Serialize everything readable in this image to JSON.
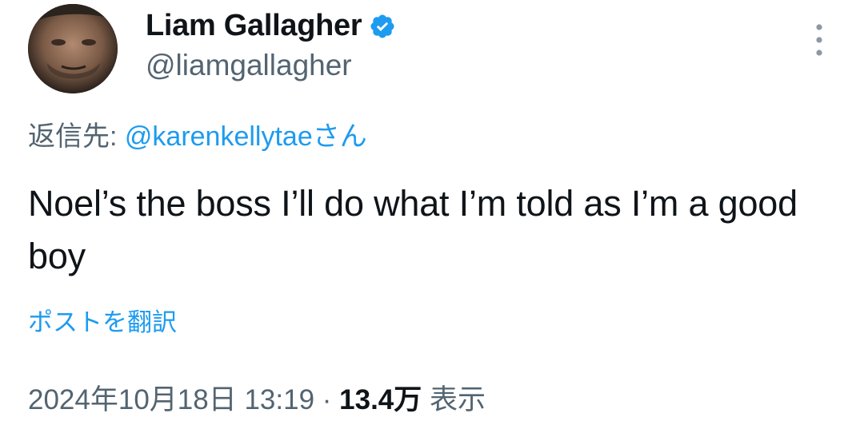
{
  "author": {
    "display_name": "Liam Gallagher",
    "handle": "@liamgallagher",
    "verified": true,
    "verified_color": "#1d9bf0"
  },
  "reply": {
    "prefix": "返信先: ",
    "mention": "@karenkellytae",
    "suffix": "さん"
  },
  "tweet": {
    "text": "Noel’s the boss I’ll do what I’m told as I’m a good boy",
    "translate_label": "ポストを翻訳"
  },
  "meta": {
    "timestamp": "2024年10月18日 13:19",
    "separator": " · ",
    "views_count": "13.4万",
    "views_label": " 表示"
  },
  "icons": {
    "avatar": "avatar",
    "verified": "verified-badge-icon",
    "more": "more-options-icon"
  },
  "colors": {
    "text_primary": "#0f1419",
    "text_secondary": "#536471",
    "accent": "#1d9bf0"
  }
}
